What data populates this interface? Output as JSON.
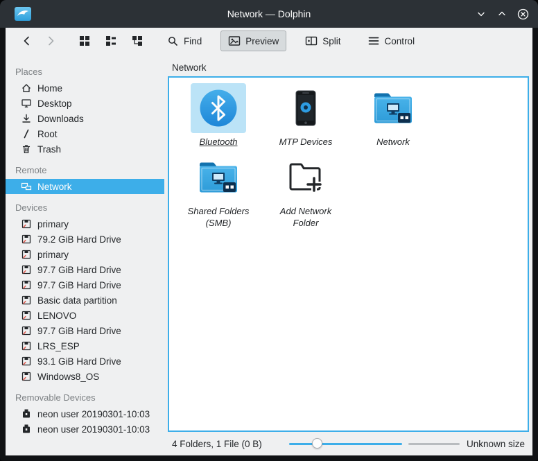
{
  "window": {
    "title": "Network — Dolphin"
  },
  "toolbar": {
    "find": "Find",
    "preview": "Preview",
    "split": "Split",
    "control": "Control"
  },
  "sidebar": {
    "sections": [
      {
        "title": "Places",
        "items": [
          {
            "label": "Home",
            "icon": "home-icon"
          },
          {
            "label": "Desktop",
            "icon": "desktop-icon"
          },
          {
            "label": "Downloads",
            "icon": "downloads-icon"
          },
          {
            "label": "Root",
            "icon": "root-icon"
          },
          {
            "label": "Trash",
            "icon": "trash-icon"
          }
        ]
      },
      {
        "title": "Remote",
        "items": [
          {
            "label": "Network",
            "icon": "network-icon",
            "selected": true
          }
        ]
      },
      {
        "title": "Devices",
        "items": [
          {
            "label": "primary",
            "icon": "device-icon"
          },
          {
            "label": "79.2 GiB Hard Drive",
            "icon": "device-icon"
          },
          {
            "label": "primary",
            "icon": "device-icon"
          },
          {
            "label": "97.7 GiB Hard Drive",
            "icon": "device-icon"
          },
          {
            "label": "97.7 GiB Hard Drive",
            "icon": "device-icon"
          },
          {
            "label": "Basic data partition",
            "icon": "device-icon"
          },
          {
            "label": "LENOVO",
            "icon": "device-icon"
          },
          {
            "label": "97.7 GiB Hard Drive",
            "icon": "device-icon"
          },
          {
            "label": "LRS_ESP",
            "icon": "device-icon"
          },
          {
            "label": "93.1 GiB Hard Drive",
            "icon": "device-icon"
          },
          {
            "label": "Windows8_OS",
            "icon": "device-icon"
          }
        ]
      },
      {
        "title": "Removable Devices",
        "items": [
          {
            "label": "neon user 20190301-10:03",
            "icon": "removable-icon"
          },
          {
            "label": "neon user 20190301-10:03",
            "icon": "removable-icon"
          }
        ]
      }
    ]
  },
  "main": {
    "location": "Network",
    "items": [
      {
        "label": "Bluetooth",
        "icon": "bluetooth-icon",
        "selected": true
      },
      {
        "label": "MTP Devices",
        "icon": "mtp-icon"
      },
      {
        "label": "Network",
        "icon": "folder-network-icon"
      },
      {
        "label": "Shared Folders (SMB)",
        "icon": "folder-network-icon"
      },
      {
        "label": "Add Network Folder",
        "icon": "add-network-folder-icon"
      }
    ],
    "statusbar": {
      "summary": "4 Folders, 1 File (0 B)",
      "size": "Unknown size"
    }
  },
  "colors": {
    "accent": "#3daee9",
    "titlebar_bg": "#2c3136",
    "window_bg": "#eff0f1",
    "view_bg": "#ffffff",
    "selection_text": "#fcfcfc"
  }
}
